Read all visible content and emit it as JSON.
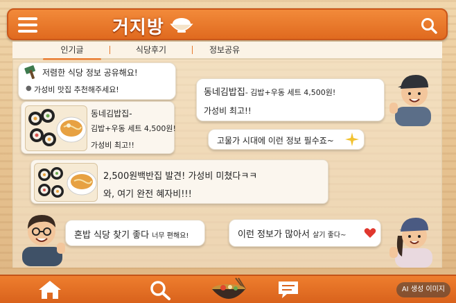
{
  "header": {
    "title": "거지방",
    "menu_icon": "hamburger-menu-icon",
    "search_icon": "search-icon",
    "brand_color": "#e8782a"
  },
  "tabs": [
    {
      "label": "인기글",
      "active": true
    },
    {
      "label": "식당후기",
      "active": false
    },
    {
      "label": "정보공유",
      "active": false
    }
  ],
  "posts": {
    "p1_title": "저렴한 식당 정보 공유해요!",
    "p1_sub": "가성비 맛집 추천해주세요!",
    "p2_title": "동네김밥집",
    "p2_title_rest": "- 김밥+우동 세트 4,500원!",
    "p2_comment": "가성비 최고!!",
    "card1_l1": "동네김밥집-",
    "card1_l2": "김밥+우동 세트 4,500원!",
    "card1_l3": "가성비 최고!!",
    "reply1": "고물가 시대에 이런 정보 필수죠~",
    "card2_l1": "2,500원백반집 발견! 가성비 미쳤다ㅋㅋ",
    "card2_l2": "와, 여기 완전 혜자비!!!",
    "bottom_left_main": "혼밥 식당 찾기 좋다",
    "bottom_left_small": "너무 편해요!",
    "bottom_right_main": "이런 정보가 많아서",
    "bottom_right_small": "살기 좋다~"
  },
  "bottom_nav": {
    "items": [
      "home-icon",
      "search-icon",
      "food-bowl-icon",
      "chat-icon"
    ],
    "ai_badge": "AI 생성 이미지"
  }
}
